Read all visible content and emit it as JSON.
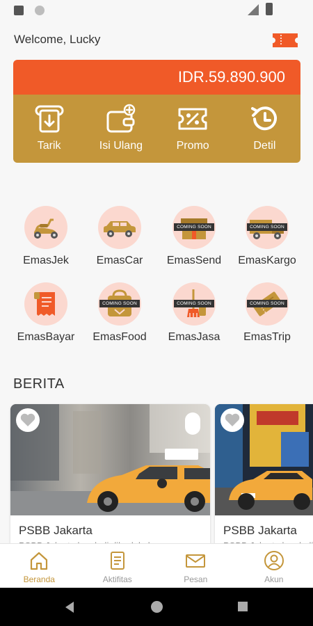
{
  "header": {
    "welcome": "Welcome, Lucky"
  },
  "wallet": {
    "balance": "IDR.59.890.900",
    "actions": [
      {
        "label": "Tarik",
        "icon": "withdraw-icon"
      },
      {
        "label": "Isi Ulang",
        "icon": "wallet-topup-icon"
      },
      {
        "label": "Promo",
        "icon": "promo-ticket-icon"
      },
      {
        "label": "Detil",
        "icon": "history-icon"
      }
    ]
  },
  "services": [
    {
      "label": "EmasJek",
      "icon": "scooter-icon"
    },
    {
      "label": "EmasCar",
      "icon": "car-icon"
    },
    {
      "label": "EmasSend",
      "icon": "package-icon",
      "badge": "COMING SOON"
    },
    {
      "label": "EmasKargo",
      "icon": "truck-icon",
      "badge": "COMING SOON"
    },
    {
      "label": "EmasBayar",
      "icon": "receipt-icon"
    },
    {
      "label": "EmasFood",
      "icon": "food-bag-icon",
      "badge": "COMING SOON"
    },
    {
      "label": "EmasJasa",
      "icon": "cleaning-icon",
      "badge": "COMING SOON"
    },
    {
      "label": "EmasTrip",
      "icon": "trip-ticket-icon",
      "badge": "COMING SOON"
    }
  ],
  "news": {
    "heading": "BERITA",
    "items": [
      {
        "title": "PSBB Jakarta",
        "snippet": "PSBB Jakarta kembali diberlakukan"
      },
      {
        "title": "PSBB Jakarta",
        "snippet": "PSBB Jakarta kembali"
      }
    ]
  },
  "bottom_nav": [
    {
      "label": "Beranda",
      "icon": "home-icon",
      "active": true
    },
    {
      "label": "Aktifitas",
      "icon": "document-icon",
      "active": false
    },
    {
      "label": "Pesan",
      "icon": "mail-icon",
      "active": false
    },
    {
      "label": "Akun",
      "icon": "user-icon",
      "active": false
    }
  ],
  "colors": {
    "primary": "#f05a28",
    "gold": "#c4963b",
    "circle_bg": "#fbd8cf"
  }
}
